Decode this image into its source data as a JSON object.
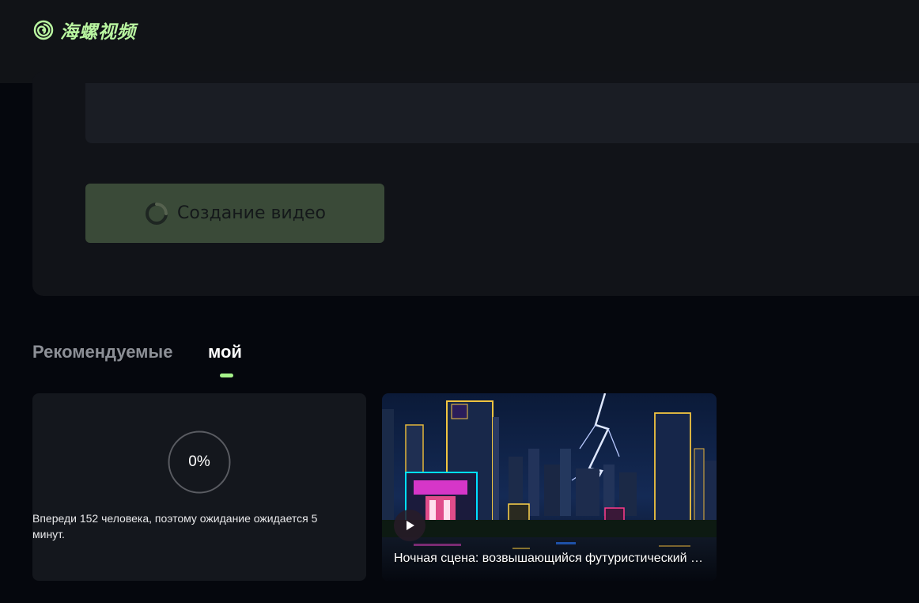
{
  "header": {
    "logo_text": "海螺视频"
  },
  "create_panel": {
    "button_label": "Создание видео"
  },
  "tabs": [
    {
      "label": "Рекомендуемые",
      "active": false
    },
    {
      "label": "мой",
      "active": true
    }
  ],
  "cards": {
    "progress": {
      "percent_label": "0%",
      "queue_text": "Впереди 152 человека, поэтому ожидание ожидается 5 минут."
    },
    "video": {
      "caption": "Ночная сцена: возвышающийся футуристический город с молниями"
    }
  },
  "colors": {
    "accent": "#a6f28a",
    "logo": "#b9f5a0",
    "button_bg": "#3a4a38",
    "panel_bg": "#111318",
    "page_bg": "#05070d"
  }
}
